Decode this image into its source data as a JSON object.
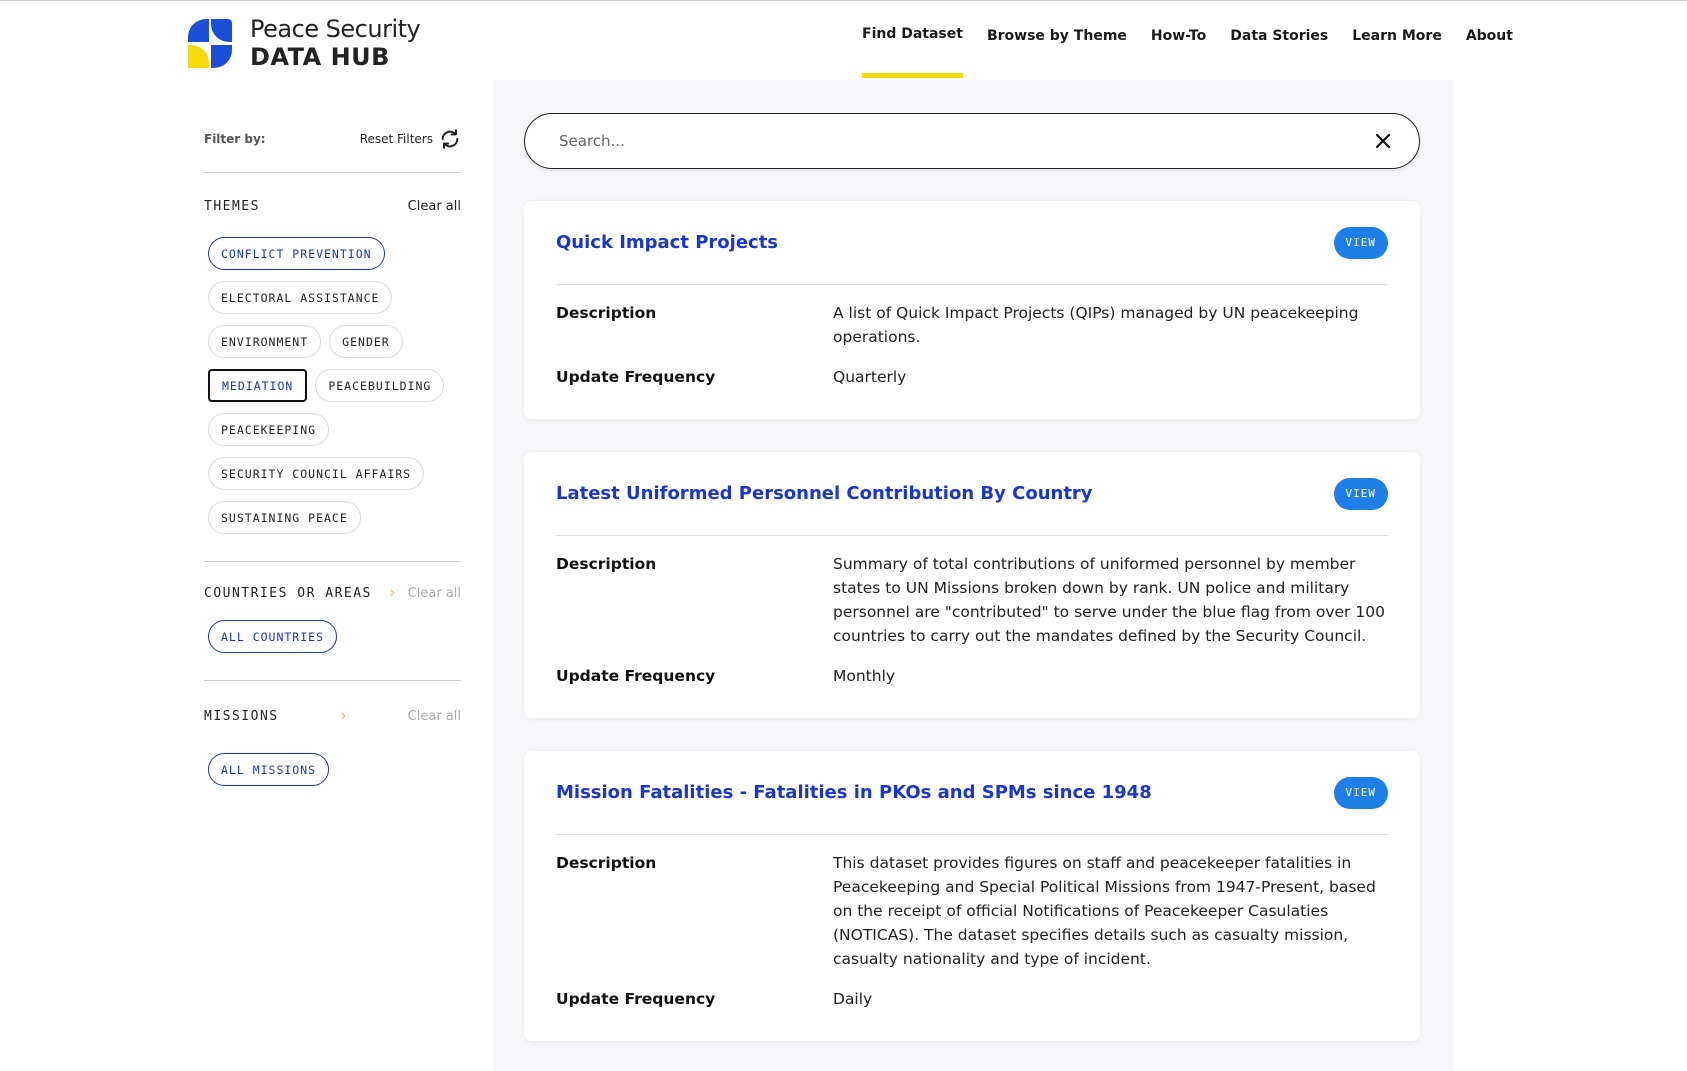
{
  "brand": {
    "line1": "Peace Security",
    "line2": "DATA HUB"
  },
  "nav": [
    "Find Dataset",
    "Browse by Theme",
    "How-To",
    "Data Stories",
    "Learn More",
    "About"
  ],
  "sidebar": {
    "filter_by": "Filter by:",
    "reset": "Reset Filters",
    "themes": {
      "title": "THEMES",
      "clear": "Clear all",
      "tags": [
        "CONFLICT PREVENTION",
        "ELECTORAL ASSISTANCE",
        "ENVIRONMENT",
        "GENDER",
        "MEDIATION",
        "PEACEBUILDING",
        "PEACEKEEPING",
        "SECURITY COUNCIL AFFAIRS",
        "SUSTAINING PEACE"
      ]
    },
    "countries": {
      "title": "COUNTRIES OR AREAS",
      "clear": "Clear all",
      "tag": "ALL COUNTRIES"
    },
    "missions": {
      "title": "MISSIONS",
      "clear": "Clear all",
      "tag": "ALL MISSIONS"
    }
  },
  "search": {
    "placeholder": "Search..."
  },
  "labels": {
    "description": "Description",
    "update_frequency": "Update Frequency",
    "view": "VIEW"
  },
  "datasets": [
    {
      "title": "Quick Impact Projects",
      "description": "A list of Quick Impact Projects (QIPs) managed by UN peacekeeping operations.",
      "frequency": "Quarterly"
    },
    {
      "title": "Latest Uniformed Personnel Contribution By Country",
      "description": "Summary of total contributions of uniformed personnel by member states to UN Missions broken down by rank. UN police and military personnel are \"contributed\" to serve under the blue flag from over 100 countries to carry out the mandates defined by the Security Council.",
      "frequency": "Monthly"
    },
    {
      "title": "Mission Fatalities - Fatalities in PKOs and SPMs since 1948",
      "description": "This dataset provides figures on staff and peacekeeper fatalities in Peacekeeping and Special Political Missions from 1947-Present, based on the receipt of official Notifications of Peacekeeper Casulaties (NOTICAS). The dataset specifies details such as casualty mission, casualty nationality and type of incident.",
      "frequency": "Daily"
    }
  ]
}
